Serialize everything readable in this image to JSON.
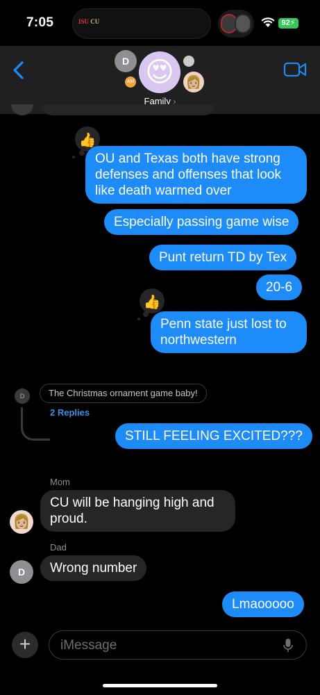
{
  "status_bar": {
    "time": "7:05",
    "battery": "92",
    "live_game_teams": [
      "ISU",
      "CU"
    ]
  },
  "header": {
    "group_name": "Family",
    "main_avatar_emoji": "😍",
    "member_initial": "D",
    "member_tag": "AM",
    "member_memoji": "👩🏼"
  },
  "messages": [
    {
      "type": "sent",
      "text": "OU and Texas both have strong defenses and offenses that look like death warmed over",
      "tapback": "👍"
    },
    {
      "type": "sent",
      "text": "Especially passing game wise"
    },
    {
      "type": "sent",
      "text": "Punt return TD by Tex"
    },
    {
      "type": "sent",
      "text": "20-6"
    },
    {
      "type": "sent",
      "text": "Penn state just lost to northwestern",
      "tapback": "👍"
    },
    {
      "type": "sent",
      "text": "STILL FEELING EXCITED???"
    },
    {
      "type": "received",
      "sender": "Mom",
      "text": "CU will be hanging high and proud."
    },
    {
      "type": "received",
      "sender": "Dad",
      "text": "Wrong number"
    },
    {
      "type": "sent",
      "text": "Lmaooooo"
    }
  ],
  "thread": {
    "avatar_initial": "D",
    "quoted_text": "The Christmas ornament game baby!",
    "replies_label": "2 Replies"
  },
  "avatars": {
    "mom_emoji": "👩🏼",
    "dad_initial": "D"
  },
  "input": {
    "placeholder": "iMessage",
    "plus_label": "+"
  },
  "colors": {
    "sent_bubble": "#1d8cf8",
    "received_bubble": "#262628",
    "accent": "#1d8cf8",
    "background": "#000000"
  }
}
